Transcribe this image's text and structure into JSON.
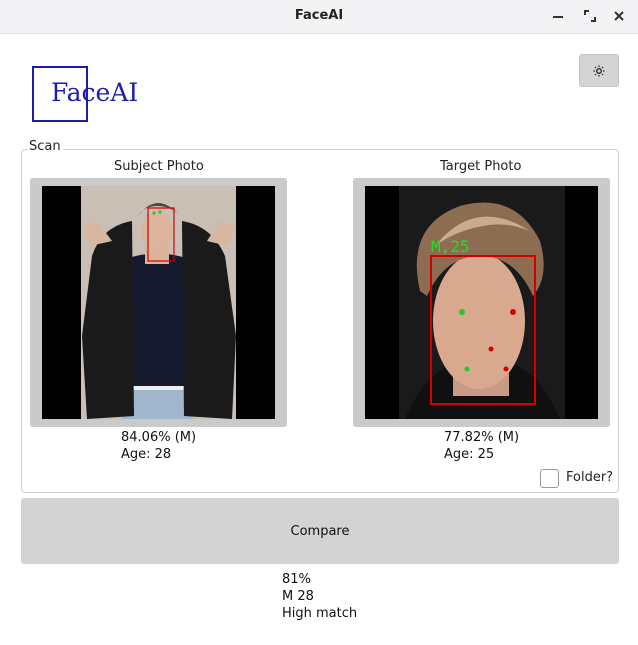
{
  "window": {
    "title": "FaceAI"
  },
  "logo": {
    "text": "FaceAI"
  },
  "scan": {
    "legend": "Scan",
    "subject": {
      "label": "Subject Photo",
      "confidence": "84.06% (M)",
      "age": "Age: 28"
    },
    "target": {
      "label": "Target Photo",
      "confidence": "77.82% (M)",
      "age": "Age: 25",
      "overlay_label": "M,25"
    }
  },
  "folder": {
    "label": "Folder?",
    "checked": false
  },
  "compare": {
    "label": "Compare"
  },
  "result": {
    "similarity": "81%",
    "summary": "M 28",
    "verdict": "High match"
  },
  "icons": {
    "minimize": "minimize-icon",
    "restore": "restore-icon",
    "close": "close-icon",
    "settings": "sun-icon"
  },
  "colors": {
    "brand": "#1c1cb0",
    "face_box": "#d40000",
    "landmark_green": "#22cc22"
  }
}
